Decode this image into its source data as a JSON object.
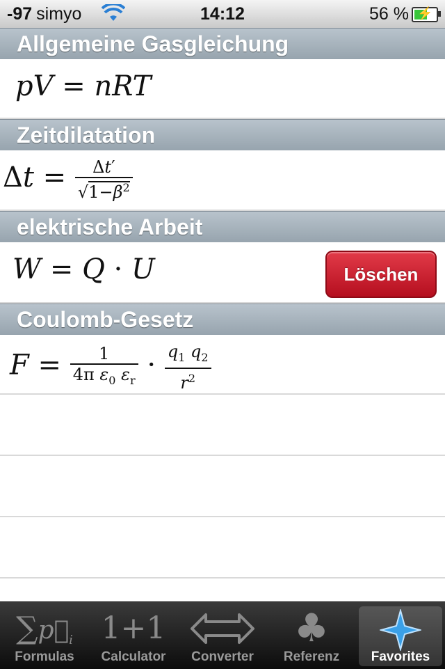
{
  "status_bar": {
    "signal": "-97",
    "carrier": "simyo",
    "time": "14:12",
    "battery": "56 %"
  },
  "sections": [
    {
      "title": "Allgemeine Gasgleichung"
    },
    {
      "title": "Zeitdilatation"
    },
    {
      "title": "elektrische Arbeit",
      "delete_label": "Löschen"
    },
    {
      "title": "Coulomb-Gesetz"
    }
  ],
  "tabs": [
    {
      "label": "Formulas",
      "icon": "sum-vector-icon"
    },
    {
      "label": "Calculator",
      "icon": "one-plus-one-icon"
    },
    {
      "label": "Converter",
      "icon": "double-arrow-icon"
    },
    {
      "label": "Referenz",
      "icon": "club-icon"
    },
    {
      "label": "Favorites",
      "icon": "star-icon",
      "active": true
    }
  ],
  "colors": {
    "section_header": "#a7b3bc",
    "delete_button": "#c8182a",
    "tab_active_icon": "#3aa0e8"
  }
}
